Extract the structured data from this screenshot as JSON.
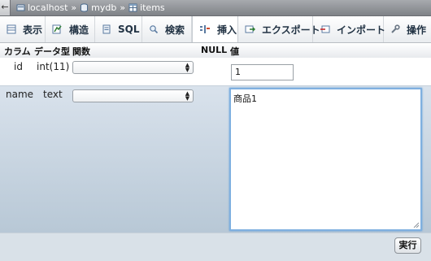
{
  "breadcrumb": {
    "back": "←",
    "items": [
      {
        "label": "localhost",
        "icon": "server-icon"
      },
      {
        "label": "mydb",
        "icon": "database-icon"
      },
      {
        "label": "items",
        "icon": "table-icon"
      }
    ],
    "separator": "»"
  },
  "tabs": [
    {
      "label": "表示",
      "icon": "browse-icon",
      "active": false
    },
    {
      "label": "構造",
      "icon": "structure-icon",
      "active": false
    },
    {
      "label": "SQL",
      "icon": "sql-icon",
      "active": false
    },
    {
      "label": "検索",
      "icon": "search-icon",
      "active": false
    },
    {
      "label": "挿入",
      "icon": "insert-icon",
      "active": true
    },
    {
      "label": "エクスポート",
      "icon": "export-icon",
      "active": false
    },
    {
      "label": "インポート",
      "icon": "import-icon",
      "active": false
    },
    {
      "label": "操作",
      "icon": "operations-icon",
      "active": false
    }
  ],
  "table": {
    "headers": {
      "column": "カラム",
      "type": "データ型",
      "function": "関数",
      "null": "NULL",
      "value": "値"
    },
    "rows": [
      {
        "column": "id",
        "type": "int(11)",
        "function": "",
        "value": "1"
      },
      {
        "column": "name",
        "type": "text",
        "function": "",
        "value": "商品1"
      }
    ]
  },
  "actions": {
    "go_label": "実行"
  },
  "colors": {
    "accent_focus": "#7fb0e0",
    "tab_text": "#223344",
    "row_bg": "#b8c8d6"
  }
}
